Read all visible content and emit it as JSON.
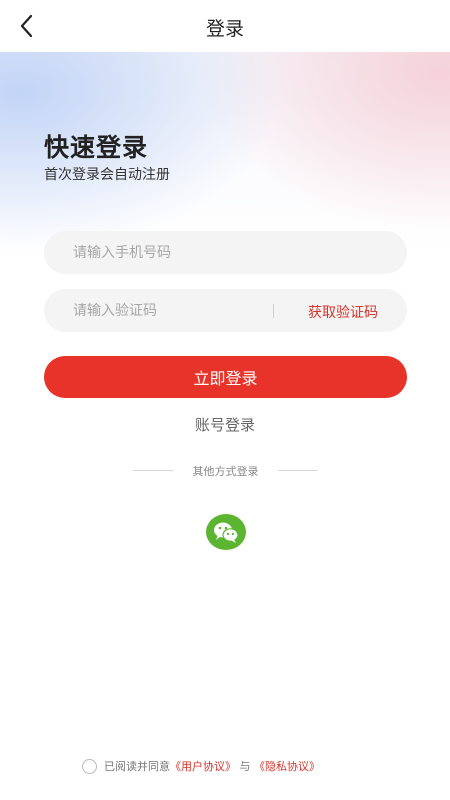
{
  "nav": {
    "title": "登录"
  },
  "header": {
    "title": "快速登录",
    "subtitle": "首次登录会自动注册"
  },
  "phone": {
    "placeholder": "请输入手机号码",
    "value": ""
  },
  "code": {
    "placeholder": "请输入验证码",
    "value": "",
    "get_code_label": "获取验证码"
  },
  "login_button": "立即登录",
  "account_login": "账号登录",
  "other_methods": {
    "label": "其他方式登录",
    "icons": [
      "wechat-icon"
    ]
  },
  "agreement": {
    "prefix": "已阅读并同意",
    "user_agreement": "《用户协议》",
    "connector": "与",
    "privacy_policy": "《隐私协议》",
    "checked": false
  },
  "colors": {
    "accent": "#e8332a",
    "link": "#d4342b",
    "wechat": "#5cb531"
  }
}
